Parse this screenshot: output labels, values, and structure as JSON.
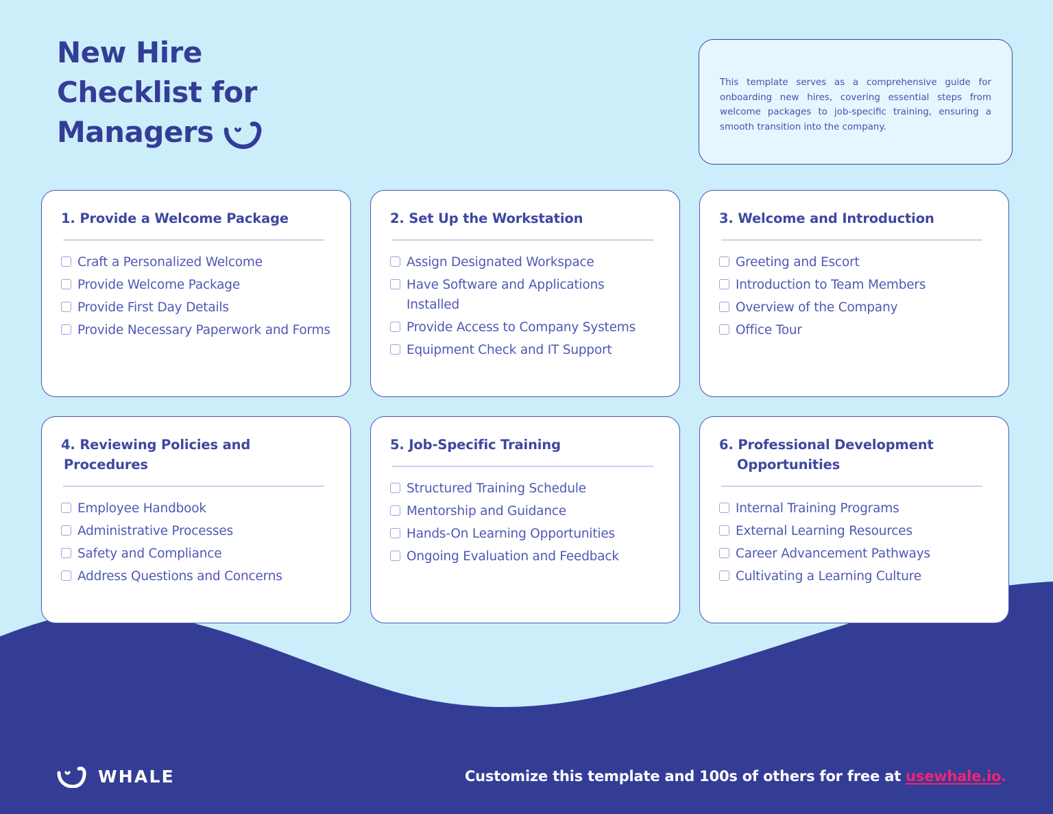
{
  "header": {
    "title_lines": [
      "New Hire",
      "Checklist for",
      "Managers"
    ],
    "whale_icon": "whale-smile-icon",
    "description": "This template serves as a comprehensive guide for onboarding new hires, covering essential steps from welcome packages to job-specific training, ensuring a smooth transition into the company."
  },
  "colors": {
    "background": "#cceefb",
    "navy": "#343d96",
    "card_border": "#4b55ae",
    "heading": "#3e47a0",
    "item_text": "#4f58b4",
    "divider": "#c9d1ee",
    "checkbox_border": "#9aa3dd",
    "desc_box_fill": "#e7f5fe",
    "link_pink": "#f0256f",
    "white": "#ffffff"
  },
  "cards": [
    {
      "title": "1. Provide a Welcome Package",
      "title_part_1": "1. Provide a Welcome Package",
      "title_part_2": "",
      "items": [
        "Craft a Personalized Welcome",
        "Provide Welcome Package",
        "Provide First Day Details",
        "Provide Necessary Paperwork and Forms"
      ]
    },
    {
      "title": "2. Set Up the Workstation",
      "title_part_1": "2. Set Up the Workstation",
      "title_part_2": "",
      "items": [
        "Assign Designated Workspace",
        "Have Software and Applications Installed",
        "Provide Access to Company Systems",
        "Equipment Check and IT Support"
      ]
    },
    {
      "title": "3. Welcome and Introduction",
      "title_part_1": "3. Welcome and Introduction",
      "title_part_2": "",
      "items": [
        "Greeting and Escort",
        "Introduction to Team Members",
        "Overview of the Company",
        "Office Tour"
      ]
    },
    {
      "title": "4. Reviewing Policies and Procedures",
      "title_part_1": "4. Reviewing Policies and Procedures",
      "title_part_2": "",
      "items": [
        "Employee Handbook",
        "Administrative Processes",
        "Safety and Compliance",
        "Address Questions and Concerns"
      ]
    },
    {
      "title": "5. Job-Specific Training",
      "title_part_1": "5. Job-Specific Training",
      "title_part_2": "",
      "items": [
        "Structured Training Schedule",
        "Mentorship and Guidance",
        "Hands-On Learning Opportunities",
        "Ongoing Evaluation and Feedback"
      ]
    },
    {
      "title": "6. Professional Development Opportunities",
      "title_part_1": "6. Professional Development",
      "title_part_2": "Opportunities",
      "items": [
        "Internal Training Programs",
        "External Learning Resources",
        "Career Advancement Pathways",
        "Cultivating a Learning Culture"
      ]
    }
  ],
  "footer": {
    "brand_name": "WHALE",
    "brand_icon": "whale-smile-icon",
    "cta_text": "Customize this template and 100s of others for free at ",
    "link_text": "usewhale.io",
    "trailing_period": "."
  }
}
